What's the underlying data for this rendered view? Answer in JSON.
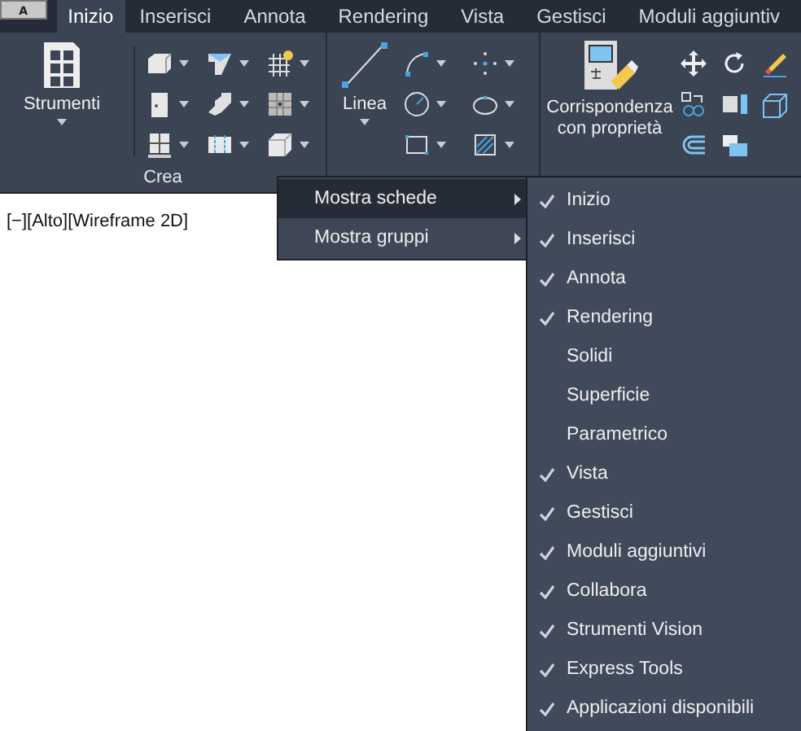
{
  "app_button": {
    "label": "A"
  },
  "tabs": [
    {
      "label": "Inizio",
      "selected": true
    },
    {
      "label": "Inserisci",
      "selected": false
    },
    {
      "label": "Annota",
      "selected": false
    },
    {
      "label": "Rendering",
      "selected": false
    },
    {
      "label": "Vista",
      "selected": false
    },
    {
      "label": "Gestisci",
      "selected": false
    },
    {
      "label": "Moduli aggiuntiv",
      "selected": false
    }
  ],
  "panels": [
    {
      "kind": "crea",
      "title": "Crea",
      "big_button": {
        "label": "Strumenti",
        "caret": true
      }
    },
    {
      "kind": "disegno",
      "big_button": {
        "label": "Linea",
        "caret": true
      }
    },
    {
      "kind": "edita",
      "big_button": {
        "label": "Corrispondenza con proprietà",
        "caret": false
      }
    }
  ],
  "viewport_label": "[−][Alto][Wireframe 2D]",
  "context_menu": {
    "items": [
      {
        "label": "Mostra schede",
        "selected": true,
        "submenu": true
      },
      {
        "label": "Mostra gruppi",
        "selected": false,
        "submenu": true
      }
    ]
  },
  "submenu": {
    "items": [
      {
        "label": "Inizio",
        "checked": true
      },
      {
        "label": "Inserisci",
        "checked": true
      },
      {
        "label": "Annota",
        "checked": true
      },
      {
        "label": "Rendering",
        "checked": true
      },
      {
        "label": "Solidi",
        "checked": false
      },
      {
        "label": "Superficie",
        "checked": false
      },
      {
        "label": "Parametrico",
        "checked": false
      },
      {
        "label": "Vista",
        "checked": true
      },
      {
        "label": "Gestisci",
        "checked": true
      },
      {
        "label": "Moduli aggiuntivi",
        "checked": true
      },
      {
        "label": "Collabora",
        "checked": true
      },
      {
        "label": "Strumenti Vision",
        "checked": true
      },
      {
        "label": "Express Tools",
        "checked": true
      },
      {
        "label": "Applicazioni disponibili",
        "checked": true
      }
    ]
  }
}
